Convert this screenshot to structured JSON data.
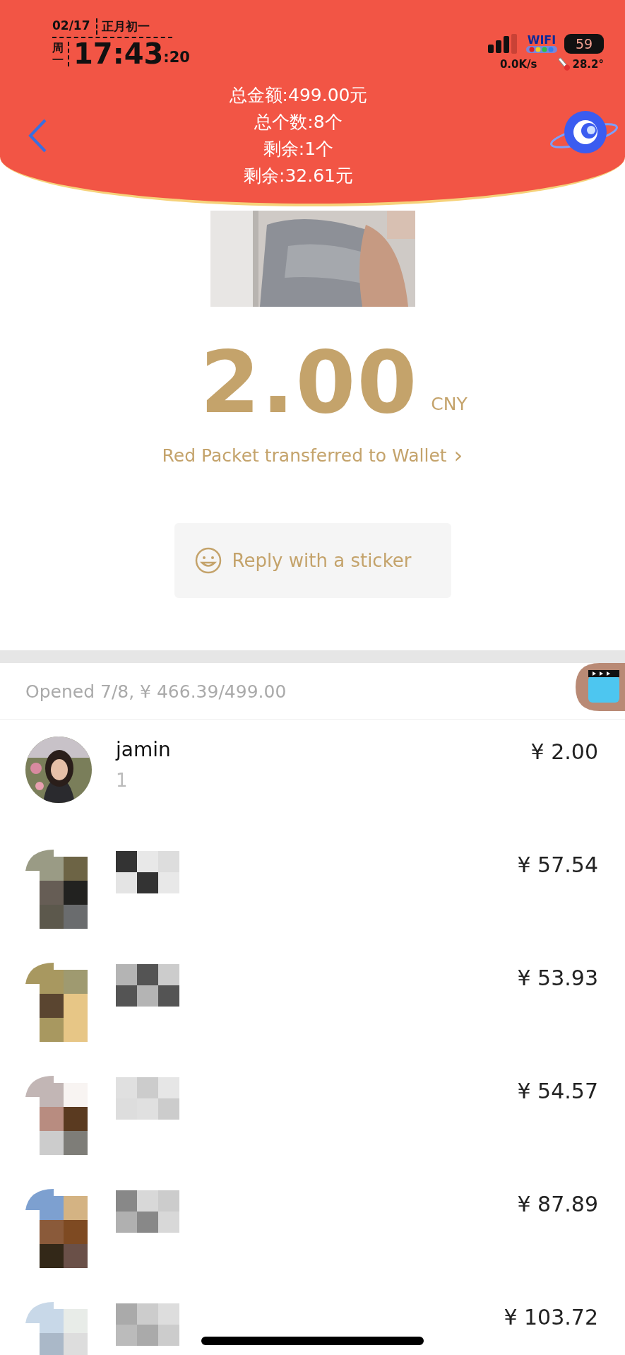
{
  "status_bar": {
    "date": "02/17",
    "lunar_date": "正月初一",
    "weekday": "周一",
    "time": "17:43",
    "seconds": ":20",
    "wifi_label": "WIFI",
    "battery": "59",
    "net_speed": "0.0K/s",
    "temperature": "28.2°"
  },
  "header": {
    "lines": [
      "总金额:499.00元",
      "总个数:8个",
      "剩余:1个",
      "剩余:32.61元"
    ]
  },
  "amount": {
    "value": "2.00",
    "currency": "CNY"
  },
  "wallet_link": {
    "label": "Red Packet transferred to Wallet",
    "arrow": "›"
  },
  "sticker_button": {
    "label": "Reply with a sticker"
  },
  "summary": "Opened 7/8, ¥ 466.39/499.00",
  "recipients": [
    {
      "name": "jamin",
      "note": "1",
      "amount": "¥ 2.00"
    },
    {
      "avatar": {
        "kind": "mosaic"
      },
      "amount": "¥ 57.54"
    },
    {
      "avatar": {
        "kind": "mosaic"
      },
      "amount": "¥ 53.93"
    },
    {
      "avatar": {
        "kind": "mosaic"
      },
      "amount": "¥ 54.57"
    },
    {
      "avatar": {
        "kind": "mosaic"
      },
      "amount": "¥ 87.89"
    },
    {
      "avatar": {
        "kind": "mosaic"
      },
      "amount": "¥ 103.72"
    }
  ]
}
